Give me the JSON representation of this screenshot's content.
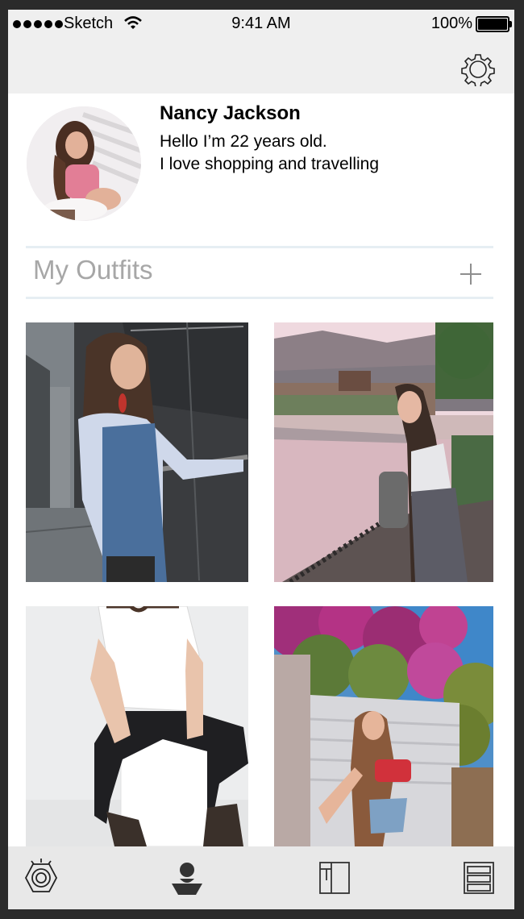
{
  "status": {
    "carrier": "Sketch",
    "time": "9:41 AM",
    "battery": "100%"
  },
  "profile": {
    "name": "Nancy Jackson",
    "bio_line1": "Hello I’m 22 years old.",
    "bio_line2": "I love shopping and travelling"
  },
  "outfits": {
    "title": "My Outfits",
    "photos": [
      {
        "desc": "girl-in-overalls-on-stairs"
      },
      {
        "desc": "girl-at-river-lake-town"
      },
      {
        "desc": "white-tee-black-jeans-boots"
      },
      {
        "desc": "girl-under-pink-flowers"
      }
    ]
  },
  "tabbar": {
    "items": [
      "lens-icon",
      "profile-icon",
      "wardrobe-icon",
      "drawers-icon"
    ],
    "active": "profile-icon"
  },
  "colors": {
    "topbar": "#efefef",
    "tabbar": "#e8e8e8",
    "divider": "#e6eef3",
    "section_title": "#a7a7a7"
  }
}
